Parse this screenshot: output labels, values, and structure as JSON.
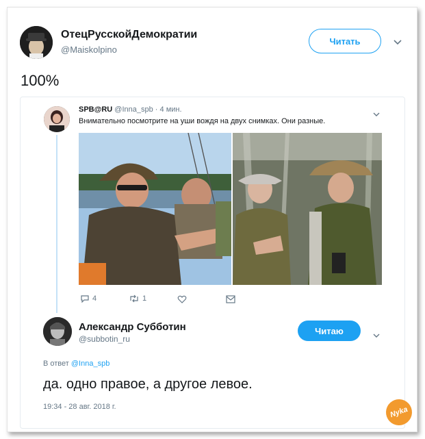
{
  "main_tweet": {
    "name": "ОтецРусскойДемократии",
    "handle": "@Maiskolpino",
    "follow_label": "Читать",
    "text": "100%"
  },
  "quoted_tweet": {
    "name": "SPB@RU",
    "handle": "@Inna_spb",
    "time": "· 4 мин.",
    "text": "Внимательно посмотрите на уши вождя на двух снимках. Они разные.",
    "replies": "4",
    "retweets": "1"
  },
  "reply_tweet": {
    "name": "Александр Субботин",
    "handle": "@subbotin_ru",
    "follow_label": "Читаю",
    "reply_prefix": "В ответ",
    "reply_to": "@Inna_spb",
    "text": "да. одно правое, а другое левое.",
    "timestamp": "19:34 - 28 авг. 2018 г."
  },
  "watermark": {
    "text": "Nyka"
  },
  "colors": {
    "accent": "#1da1f2",
    "muted": "#657786",
    "watermark": "#f29a2e"
  }
}
